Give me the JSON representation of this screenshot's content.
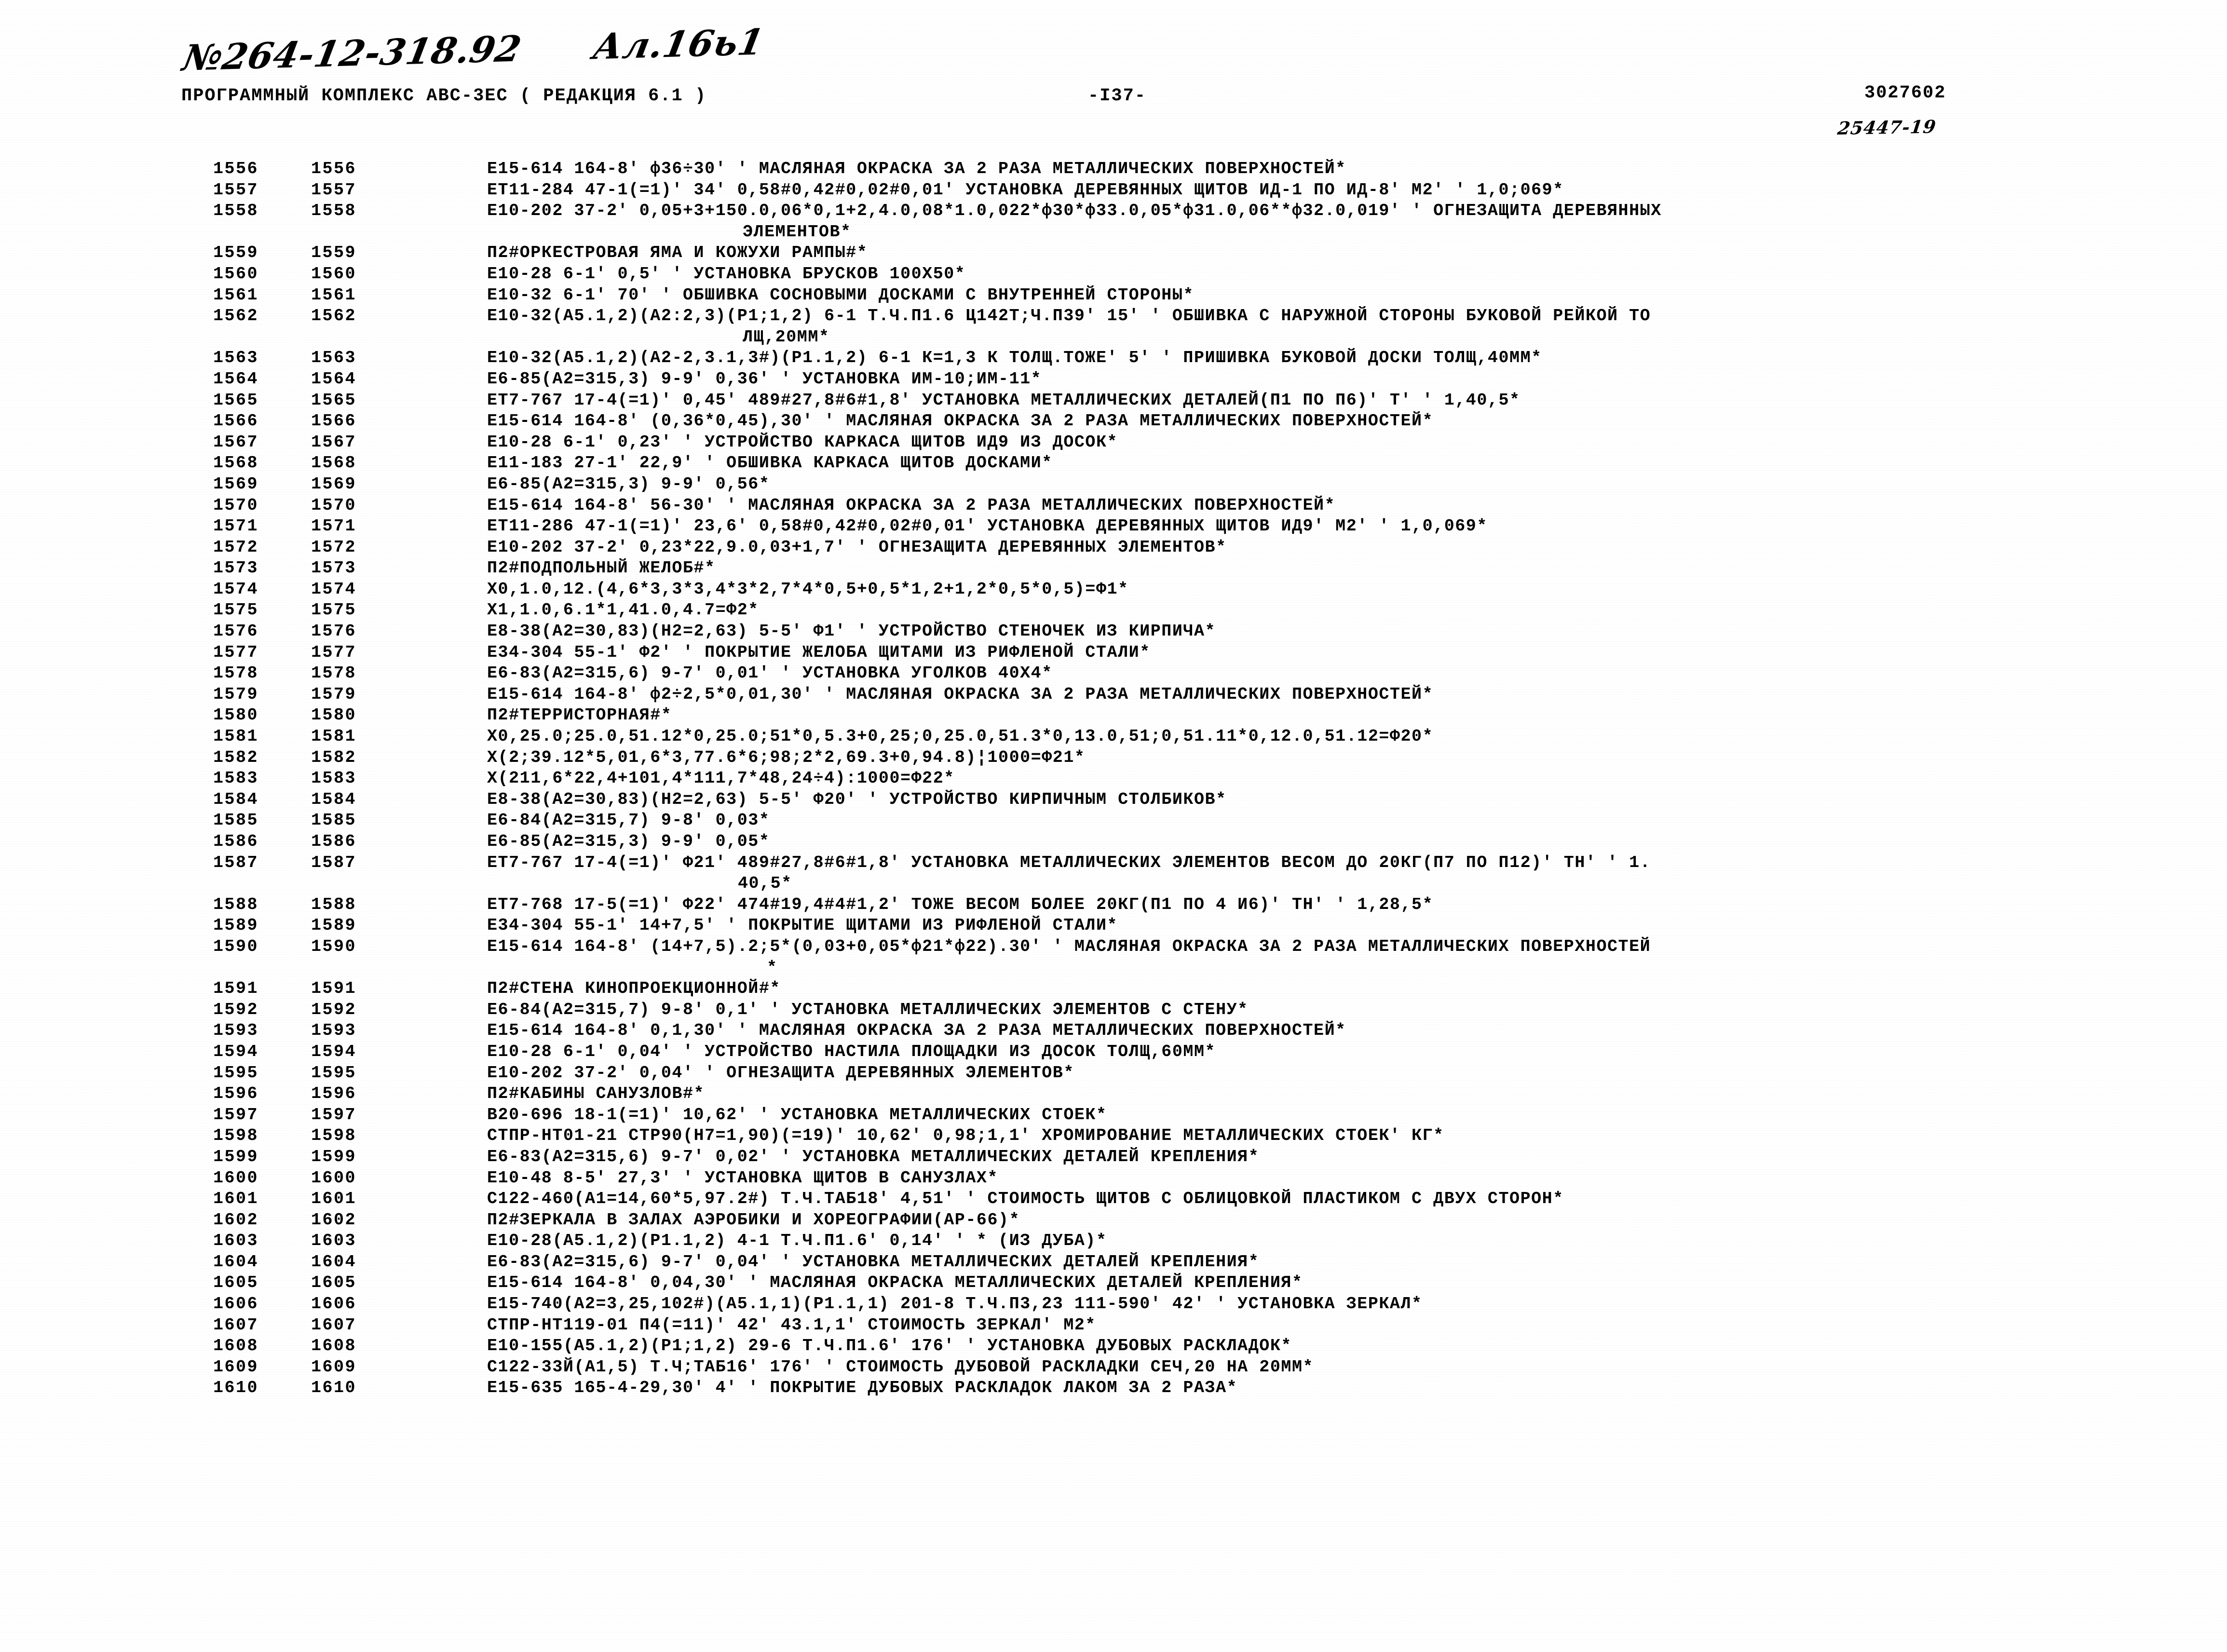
{
  "handwriting": {
    "code": "№264-12-318.92",
    "sheet": "Ал.16ь1"
  },
  "header": {
    "program_title": "ПРОГРАММНЫЙ КОМПЛЕКС АВС-3ЕС   ( РЕДАКЦИЯ  6.1 )",
    "page_number": "-I37-",
    "doc_number": "3027602",
    "order_number": "25447-19"
  },
  "listing": {
    "rows": [
      {
        "num_a": "1556",
        "num_b": "1556",
        "body": "Е15-614 164-8' ф36÷30' ' МАСЛЯНАЯ ОКРАСКА ЗА 2 РАЗА МЕТАЛЛИЧЕСКИХ ПОВЕРХНОСТЕЙ*"
      },
      {
        "num_a": "1557",
        "num_b": "1557",
        "body": "ЕТ11-284 47-1(=1)' 34' 0,58#0,42#0,02#0,01' УСТАНОВКА ДЕРЕВЯННЫХ ЩИТОВ ИД-1 ПО ИД-8' М2' ' 1,0;069*"
      },
      {
        "num_a": "1558",
        "num_b": "1558",
        "body": "Е10-202 37-2' 0,05+3+150.0,06*0,1+2,4.0,08*1.0,022*ф30*ф33.0,05*ф31.0,06**ф32.0,019' ' ОГНЕЗАЩИТА ДЕРЕВЯННЫХ"
      },
      {
        "num_a": "",
        "num_b": "",
        "cont": true,
        "indent": 2,
        "body": "ЭЛЕМЕНТОВ*"
      },
      {
        "num_a": "1559",
        "num_b": "1559",
        "body": "П2#ОРКЕСТРОВАЯ ЯМА И КОЖУХИ РАМПЫ#*"
      },
      {
        "num_a": "1560",
        "num_b": "1560",
        "body": "Е10-28 6-1' 0,5' ' УСТАНОВКА БРУСКОВ 100Х50*"
      },
      {
        "num_a": "1561",
        "num_b": "1561",
        "body": "Е10-32 6-1' 70' ' ОБШИВКА СОСНОВЫМИ ДОСКАМИ С ВНУТРЕННЕЙ СТОРОНЫ*"
      },
      {
        "num_a": "1562",
        "num_b": "1562",
        "body": "Е10-32(А5.1,2)(А2:2,3)(Р1;1,2) 6-1 Т.Ч.П1.6 Ц142Т;Ч.П39' 15' ' ОБШИВКА С НАРУЖНОЙ СТОРОНЫ БУКОВОЙ РЕЙКОЙ ТО"
      },
      {
        "num_a": "",
        "num_b": "",
        "cont": true,
        "indent": 2,
        "body": "ЛЩ,20ММ*"
      },
      {
        "num_a": "1563",
        "num_b": "1563",
        "body": "Е10-32(А5.1,2)(А2-2,3.1,3#)(Р1.1,2) 6-1 К=1,3 К ТОЛЩ.ТОЖЕ' 5' ' ПРИШИВКА БУКОВОЙ ДОСКИ ТОЛЩ,40ММ*"
      },
      {
        "num_a": "1564",
        "num_b": "1564",
        "body": "Е6-85(А2=315,3) 9-9' 0,36' ' УСТАНОВКА ИМ-10;ИМ-11*"
      },
      {
        "num_a": "1565",
        "num_b": "1565",
        "body": "ЕТ7-767 17-4(=1)' 0,45' 489#27,8#6#1,8' УСТАНОВКА МЕТАЛЛИЧЕСКИХ ДЕТАЛЕЙ(П1 ПО П6)' Т' ' 1,40,5*"
      },
      {
        "num_a": "1566",
        "num_b": "1566",
        "body": "Е15-614 164-8' (0,36*0,45),30' ' МАСЛЯНАЯ ОКРАСКА ЗА 2 РАЗА МЕТАЛЛИЧЕСКИХ ПОВЕРХНОСТЕЙ*"
      },
      {
        "num_a": "1567",
        "num_b": "1567",
        "body": "Е10-28 6-1' 0,23' ' УСТРОЙСТВО КАРКАСА ЩИТОВ ИД9 ИЗ ДОСОК*"
      },
      {
        "num_a": "1568",
        "num_b": "1568",
        "body": "Е11-183 27-1' 22,9' ' ОБШИВКА КАРКАСА ЩИТОВ ДОСКАМИ*"
      },
      {
        "num_a": "1569",
        "num_b": "1569",
        "body": "Е6-85(А2=315,3) 9-9' 0,56*"
      },
      {
        "num_a": "1570",
        "num_b": "1570",
        "body": "Е15-614 164-8' 56-30' ' МАСЛЯНАЯ ОКРАСКА ЗА 2 РАЗА МЕТАЛЛИЧЕСКИХ ПОВЕРХНОСТЕЙ*"
      },
      {
        "num_a": "1571",
        "num_b": "1571",
        "body": "ЕТ11-286 47-1(=1)' 23,6' 0,58#0,42#0,02#0,01' УСТАНОВКА ДЕРЕВЯННЫХ ЩИТОВ ИД9' М2' ' 1,0,069*"
      },
      {
        "num_a": "1572",
        "num_b": "1572",
        "body": "Е10-202 37-2' 0,23*22,9.0,03+1,7' ' ОГНЕЗАЩИТА ДЕРЕВЯННЫХ ЭЛЕМЕНТОВ*"
      },
      {
        "num_a": "1573",
        "num_b": "1573",
        "body": "П2#ПОДПОЛЬНЫЙ ЖЕЛОБ#*"
      },
      {
        "num_a": "1574",
        "num_b": "1574",
        "body": "Х0,1.0,12.(4,6*3,3*3,4*3*2,7*4*0,5+0,5*1,2+1,2*0,5*0,5)=Ф1*"
      },
      {
        "num_a": "1575",
        "num_b": "1575",
        "body": "Х1,1.0,6.1*1,41.0,4.7=Ф2*"
      },
      {
        "num_a": "1576",
        "num_b": "1576",
        "body": "Е8-38(А2=30,83)(Н2=2,63) 5-5' Ф1' ' УСТРОЙСТВО СТЕНОЧЕК ИЗ КИРПИЧА*"
      },
      {
        "num_a": "1577",
        "num_b": "1577",
        "body": "Е34-304 55-1' Ф2' ' ПОКРЫТИЕ ЖЕЛОБА ЩИТАМИ ИЗ РИФЛЕНОЙ СТАЛИ*"
      },
      {
        "num_a": "1578",
        "num_b": "1578",
        "body": "Е6-83(А2=315,6) 9-7' 0,01' ' УСТАНОВКА УГОЛКОВ 40Х4*"
      },
      {
        "num_a": "1579",
        "num_b": "1579",
        "body": "Е15-614 164-8' ф2÷2,5*0,01,30' ' МАСЛЯНАЯ ОКРАСКА ЗА 2 РАЗА МЕТАЛЛИЧЕСКИХ ПОВЕРХНОСТЕЙ*"
      },
      {
        "num_a": "1580",
        "num_b": "1580",
        "body": "П2#ТЕРРИСТОРНАЯ#*"
      },
      {
        "num_a": "1581",
        "num_b": "1581",
        "body": "Х0,25.0;25.0,51.12*0,25.0;51*0,5.3+0,25;0,25.0,51.3*0,13.0,51;0,51.11*0,12.0,51.12=Ф20*"
      },
      {
        "num_a": "1582",
        "num_b": "1582",
        "body": "Х(2;39.12*5,01,6*3,77.6*6;98;2*2,69.3+0,94.8)¦1000=Ф21*"
      },
      {
        "num_a": "1583",
        "num_b": "1583",
        "body": "Х(211,6*22,4+101,4*111,7*48,24÷4):1000=Ф22*"
      },
      {
        "num_a": "1584",
        "num_b": "1584",
        "body": "Е8-38(А2=30,83)(Н2=2,63) 5-5' Ф20' ' УСТРОЙСТВО КИРПИЧНЫМ СТОЛБИКОВ*"
      },
      {
        "num_a": "1585",
        "num_b": "1585",
        "body": "Е6-84(А2=315,7) 9-8' 0,03*"
      },
      {
        "num_a": "1586",
        "num_b": "1586",
        "body": "Е6-85(А2=315,3) 9-9' 0,05*"
      },
      {
        "num_a": "1587",
        "num_b": "1587",
        "body": "ЕТ7-767 17-4(=1)' Ф21' 489#27,8#6#1,8' УСТАНОВКА МЕТАЛЛИЧЕСКИХ ЭЛЕМЕНТОВ ВЕСОМ ДО 20КГ(П7 ПО П12)' ТН' ' 1."
      },
      {
        "num_a": "",
        "num_b": "",
        "cont": true,
        "indent": 1,
        "body": "40,5*"
      },
      {
        "num_a": "1588",
        "num_b": "1588",
        "body": "ЕТ7-768 17-5(=1)' Ф22' 474#19,4#4#1,2' ТОЖЕ ВЕСОМ БОЛЕЕ 20КГ(П1 ПО 4 И6)' ТН' ' 1,28,5*"
      },
      {
        "num_a": "1589",
        "num_b": "1589",
        "body": "Е34-304 55-1' 14+7,5' ' ПОКРЫТИЕ ЩИТАМИ ИЗ РИФЛЕНОЙ СТАЛИ*"
      },
      {
        "num_a": "1590",
        "num_b": "1590",
        "body": "Е15-614 164-8' (14+7,5).2;5*(0,03+0,05*ф21*ф22).30' ' МАСЛЯНАЯ ОКРАСКА ЗА 2 РАЗА МЕТАЛЛИЧЕСКИХ ПОВЕРХНОСТЕЙ"
      },
      {
        "num_a": "",
        "num_b": "",
        "cont": true,
        "indent": 3,
        "body": "*"
      },
      {
        "num_a": "1591",
        "num_b": "1591",
        "body": "П2#СТЕНА КИНОПРОЕКЦИОННОЙ#*"
      },
      {
        "num_a": "1592",
        "num_b": "1592",
        "body": "Е6-84(А2=315,7) 9-8' 0,1' ' УСТАНОВКА МЕТАЛЛИЧЕСКИХ ЭЛЕМЕНТОВ С СТЕНУ*"
      },
      {
        "num_a": "1593",
        "num_b": "1593",
        "body": "Е15-614 164-8' 0,1,30' ' МАСЛЯНАЯ ОКРАСКА ЗА 2 РАЗА МЕТАЛЛИЧЕСКИХ ПОВЕРХНОСТЕЙ*"
      },
      {
        "num_a": "1594",
        "num_b": "1594",
        "body": "Е10-28 6-1' 0,04' ' УСТРОЙСТВО НАСТИЛА ПЛОЩАДКИ ИЗ ДОСОК ТОЛЩ,60ММ*"
      },
      {
        "num_a": "1595",
        "num_b": "1595",
        "body": "Е10-202 37-2' 0,04' ' ОГНЕЗАЩИТА ДЕРЕВЯННЫХ ЭЛЕМЕНТОВ*"
      },
      {
        "num_a": "1596",
        "num_b": "1596",
        "body": "П2#КАБИНЫ САНУЗЛОВ#*"
      },
      {
        "num_a": "1597",
        "num_b": "1597",
        "body": "В20-696 18-1(=1)' 10,62' ' УСТАНОВКА МЕТАЛЛИЧЕСКИХ СТОЕК*"
      },
      {
        "num_a": "1598",
        "num_b": "1598",
        "body": "СТПР-НТ01-21 СТР90(Н7=1,90)(=19)' 10,62' 0,98;1,1' ХРОМИРОВАНИЕ МЕТАЛЛИЧЕСКИХ СТОЕК' КГ*"
      },
      {
        "num_a": "1599",
        "num_b": "1599",
        "body": "Е6-83(А2=315,6) 9-7' 0,02' ' УСТАНОВКА МЕТАЛЛИЧЕСКИХ ДЕТАЛЕЙ КРЕПЛЕНИЯ*"
      },
      {
        "num_a": "1600",
        "num_b": "1600",
        "body": "Е10-48 8-5' 27,3' ' УСТАНОВКА ЩИТОВ В САНУЗЛАХ*"
      },
      {
        "num_a": "1601",
        "num_b": "1601",
        "body": "С122-460(А1=14,60*5,97.2#) Т.Ч.ТАБ18' 4,51' ' СТОИМОСТЬ ЩИТОВ С ОБЛИЦОВКОЙ ПЛАСТИКОМ С ДВУХ СТОРОН*"
      },
      {
        "num_a": "1602",
        "num_b": "1602",
        "body": "П2#ЗЕРКАЛА В ЗАЛАХ АЭРОБИКИ И ХОРЕОГРАФИИ(АР-66)*"
      },
      {
        "num_a": "1603",
        "num_b": "1603",
        "body": "Е10-28(А5.1,2)(Р1.1,2) 4-1 Т.Ч.П1.6' 0,14' ' * (ИЗ ДУБА)*"
      },
      {
        "num_a": "1604",
        "num_b": "1604",
        "body": "Е6-83(А2=315,6) 9-7' 0,04' ' УСТАНОВКА МЕТАЛЛИЧЕСКИХ ДЕТАЛЕЙ КРЕПЛЕНИЯ*"
      },
      {
        "num_a": "1605",
        "num_b": "1605",
        "body": "Е15-614 164-8' 0,04,30' ' МАСЛЯНАЯ ОКРАСКА МЕТАЛЛИЧЕСКИХ ДЕТАЛЕЙ КРЕПЛЕНИЯ*"
      },
      {
        "num_a": "1606",
        "num_b": "1606",
        "body": "Е15-740(А2=3,25,102#)(А5.1,1)(Р1.1,1) 201-8 Т.Ч.П3,23 111-590' 42' ' УСТАНОВКА ЗЕРКАЛ*"
      },
      {
        "num_a": "1607",
        "num_b": "1607",
        "body": "СТПР-НТ119-01 П4(=11)' 42' 43.1,1' СТОИМОСТЬ ЗЕРКАЛ' М2*"
      },
      {
        "num_a": "1608",
        "num_b": "1608",
        "body": "Е10-155(А5.1,2)(Р1;1,2) 29-6 Т.Ч.П1.6' 176' ' УСТАНОВКА ДУБОВЫХ РАСКЛАДОК*"
      },
      {
        "num_a": "1609",
        "num_b": "1609",
        "body": "С122-33Й(А1,5) Т.Ч;ТАБ16' 176' ' СТОИМОСТЬ ДУБОВОЙ РАСКЛАДКИ СЕЧ,20 НА 20ММ*"
      },
      {
        "num_a": "1610",
        "num_b": "1610",
        "body": "Е15-635 165-4-29,30' 4' ' ПОКРЫТИЕ ДУБОВЫХ РАСКЛАДОК ЛАКОМ ЗА 2 РАЗА*"
      }
    ]
  }
}
